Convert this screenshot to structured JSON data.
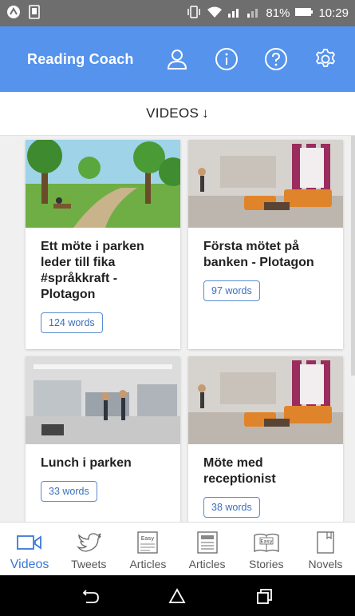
{
  "status_bar": {
    "battery": "81%",
    "time": "10:29"
  },
  "app_bar": {
    "title": "Reading Coach",
    "icons": [
      "person-icon",
      "info-icon",
      "help-icon",
      "settings-icon"
    ]
  },
  "sort": {
    "label": "VIDEOS",
    "direction_icon": "arrow-down-icon"
  },
  "cards": [
    {
      "title": "Ett möte i parken leder till fika #språkkraft - Plotagon",
      "words": "124 words",
      "thumb": "park-scene"
    },
    {
      "title": "Första mötet på banken - Plotagon",
      "words": "97 words",
      "thumb": "lounge-scene"
    },
    {
      "title": "Lunch i parken",
      "words": "33 words",
      "thumb": "office-scene"
    },
    {
      "title": "Möte med receptionist",
      "words": "38 words",
      "thumb": "lounge-scene"
    }
  ],
  "bottom_nav": [
    {
      "label": "Videos",
      "icon": "video-icon",
      "active": true
    },
    {
      "label": "Tweets",
      "icon": "bird-icon",
      "active": false
    },
    {
      "label": "Articles",
      "icon": "easy-article-icon",
      "badge": "Easy",
      "active": false
    },
    {
      "label": "Articles",
      "icon": "newspaper-icon",
      "active": false
    },
    {
      "label": "Stories",
      "icon": "easy-book-icon",
      "badge": "Easy",
      "active": false
    },
    {
      "label": "Novels",
      "icon": "book-icon",
      "active": false
    }
  ],
  "colors": {
    "app_bar": "#5593ec",
    "accent": "#3a78d8",
    "status_bar": "#6e6e6e"
  }
}
